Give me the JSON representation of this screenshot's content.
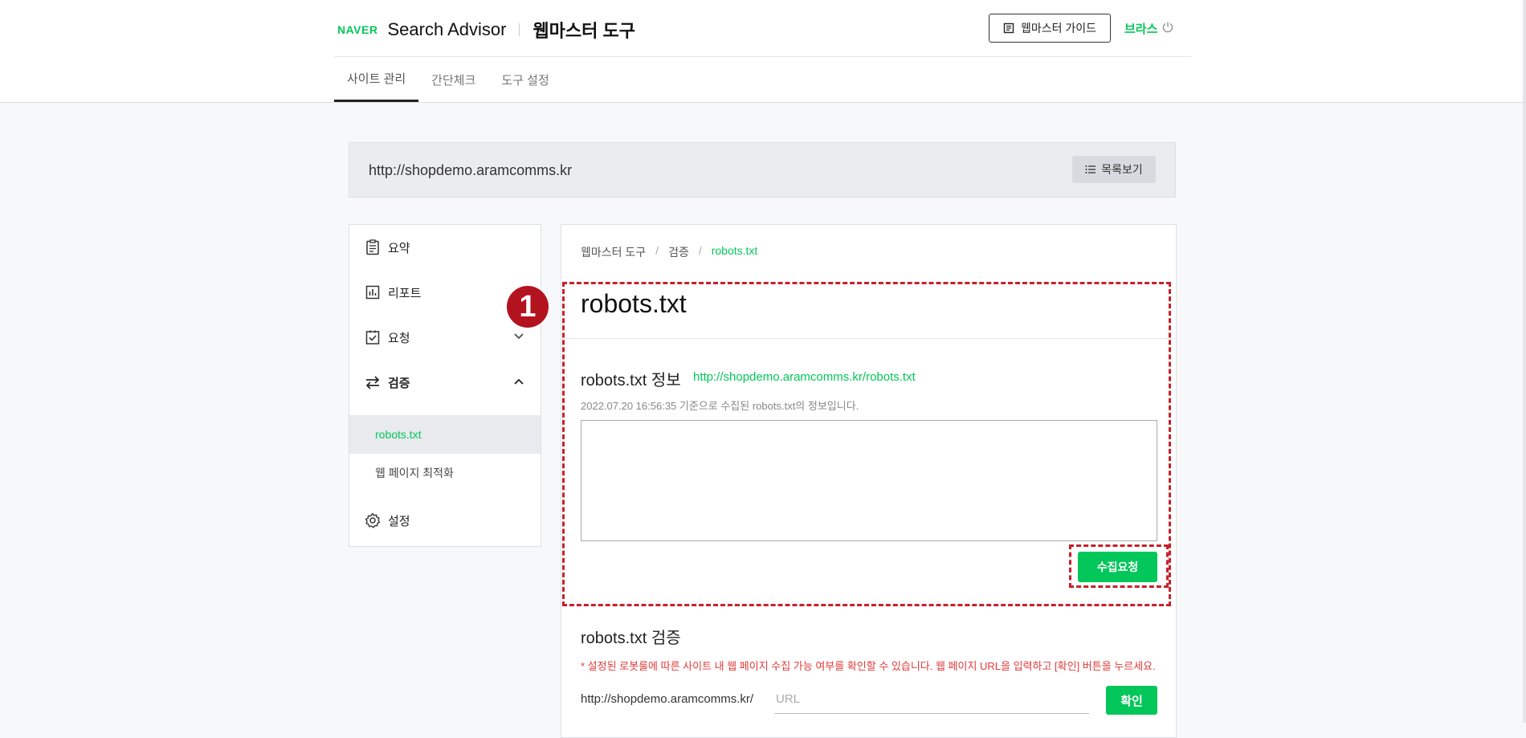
{
  "header": {
    "logo_text": "NAVER",
    "brand": "Search Advisor",
    "tool_name": "웹마스터 도구",
    "guide_button": "웹마스터 가이드",
    "user_name": "브라스",
    "tabs": [
      {
        "label": "사이트 관리",
        "active": true
      },
      {
        "label": "간단체크",
        "active": false
      },
      {
        "label": "도구 설정",
        "active": false
      }
    ]
  },
  "site": {
    "url": "http://shopdemo.aramcomms.kr",
    "list_button": "목록보기"
  },
  "sidebar": {
    "items": [
      {
        "label": "요약",
        "icon": "clipboard-icon"
      },
      {
        "label": "리포트",
        "icon": "chart-icon"
      },
      {
        "label": "요청",
        "icon": "checklist-icon",
        "expanded": false
      },
      {
        "label": "검증",
        "icon": "sync-icon",
        "expanded": true
      }
    ],
    "sub_items": [
      {
        "label": "robots.txt",
        "active": true
      },
      {
        "label": "웹 페이지 최적화",
        "active": false
      }
    ],
    "settings_label": "설정"
  },
  "main": {
    "breadcrumb": [
      "웹마스터 도구",
      "검증",
      "robots.txt"
    ],
    "title": "robots.txt",
    "info": {
      "title": "robots.txt 정보",
      "link": "http://shopdemo.aramcomms.kr/robots.txt",
      "collected_note": "2022.07.20 16:56:35 기준으로 수집된 robots.txt의 정보입니다.",
      "content": "",
      "collect_button": "수집요청"
    },
    "validation": {
      "title": "robots.txt 검증",
      "warning": "* 설정된 로봇룰에 따른 사이트 내 웹 페이지 수집 가능 여부를 확인할 수 있습니다. 웹 페이지 URL을 입력하고 [확인] 버튼을 누르세요.",
      "url_prefix": "http://shopdemo.aramcomms.kr/",
      "url_value": "",
      "url_placeholder": "URL",
      "confirm_button": "확인"
    }
  },
  "annotation": {
    "step_number": "1",
    "color": "#c8202d"
  },
  "colors": {
    "accent": "#03c75a",
    "warning": "#e03a3a"
  }
}
